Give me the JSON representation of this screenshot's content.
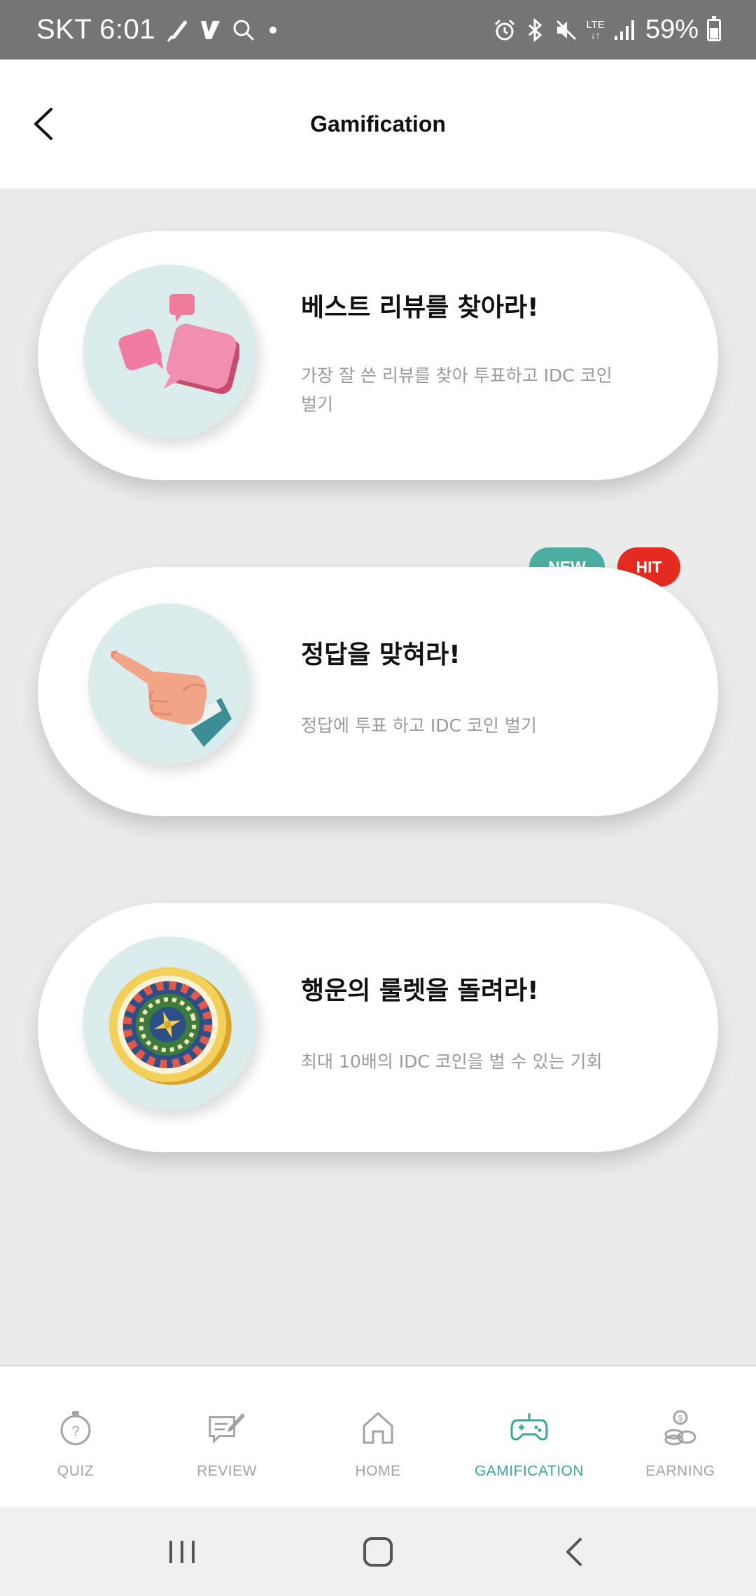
{
  "status_bar": {
    "carrier_time": "SKT 6:01",
    "network": "LTE",
    "battery": "59%",
    "icons": [
      "feather-icon",
      "vs-icon",
      "search-icon",
      "dot-icon",
      "alarm-icon",
      "bluetooth-icon",
      "mute-icon",
      "lte-icon",
      "signal-icon",
      "battery-icon"
    ]
  },
  "header": {
    "title": "Gamification",
    "back_icon": "chevron-left-icon"
  },
  "cards": [
    {
      "title": "베스트 리뷰를 찾아라!",
      "description": "가장 잘 쓴 리뷰를 찾아 투표하고 IDC 코인 벌기",
      "icon": "speech-bubbles-icon"
    },
    {
      "title": "정답을 맞혀라!",
      "description": "정답에 투표 하고 IDC 코인 벌기",
      "icon": "pointing-hand-icon",
      "badges": [
        "NEW",
        "HIT"
      ]
    },
    {
      "title": "행운의 룰렛을 돌려라!",
      "description": "최대 10배의 IDC 코인을 벌 수 있는 기회",
      "icon": "roulette-icon"
    }
  ],
  "bottom_nav": {
    "items": [
      {
        "label": "QUIZ",
        "icon": "stopwatch-icon"
      },
      {
        "label": "REVIEW",
        "icon": "review-icon"
      },
      {
        "label": "HOME",
        "icon": "home-icon"
      },
      {
        "label": "GAMIFICATION",
        "icon": "gamepad-icon",
        "active": true
      },
      {
        "label": "EARNING",
        "icon": "coins-icon"
      }
    ]
  },
  "colors": {
    "accent": "#3aa59a",
    "badge_new": "#4aaea0",
    "badge_hit": "#e52b20",
    "status_bar": "#757575",
    "background": "#ebebeb"
  }
}
